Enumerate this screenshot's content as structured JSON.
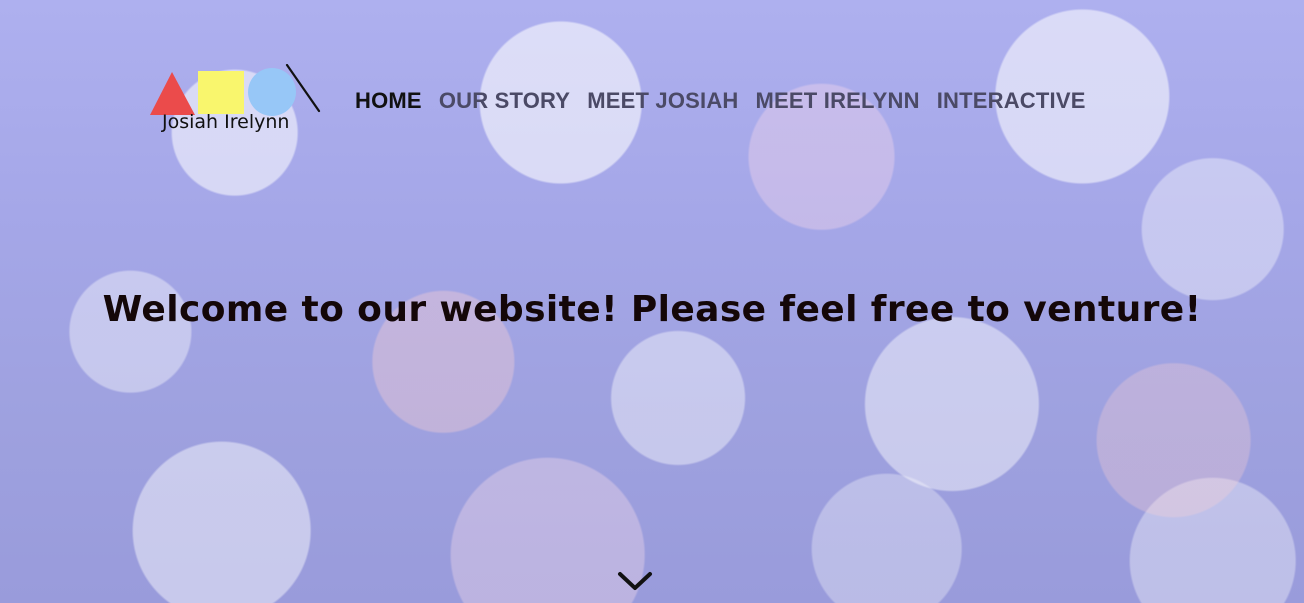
{
  "brand": {
    "logo_text": "Josiah Irelynn",
    "colors": {
      "triangle": "#eb4b4b",
      "square": "#f9f66d",
      "circle": "#97c7f7",
      "line": "#111111"
    }
  },
  "nav": {
    "items": [
      {
        "label": "HOME",
        "active": true
      },
      {
        "label": "OUR STORY",
        "active": false
      },
      {
        "label": "MEET JOSIAH",
        "active": false
      },
      {
        "label": "MEET IRELYNN",
        "active": false
      },
      {
        "label": "INTERACTIVE",
        "active": false
      }
    ],
    "colors": {
      "active": "#111111",
      "inactive": "#4b4a66"
    }
  },
  "hero": {
    "title": "Welcome to our website! Please feel free to venture!",
    "title_color": "#140708"
  },
  "scroll_indicator": {
    "icon": "chevron-down-icon"
  }
}
